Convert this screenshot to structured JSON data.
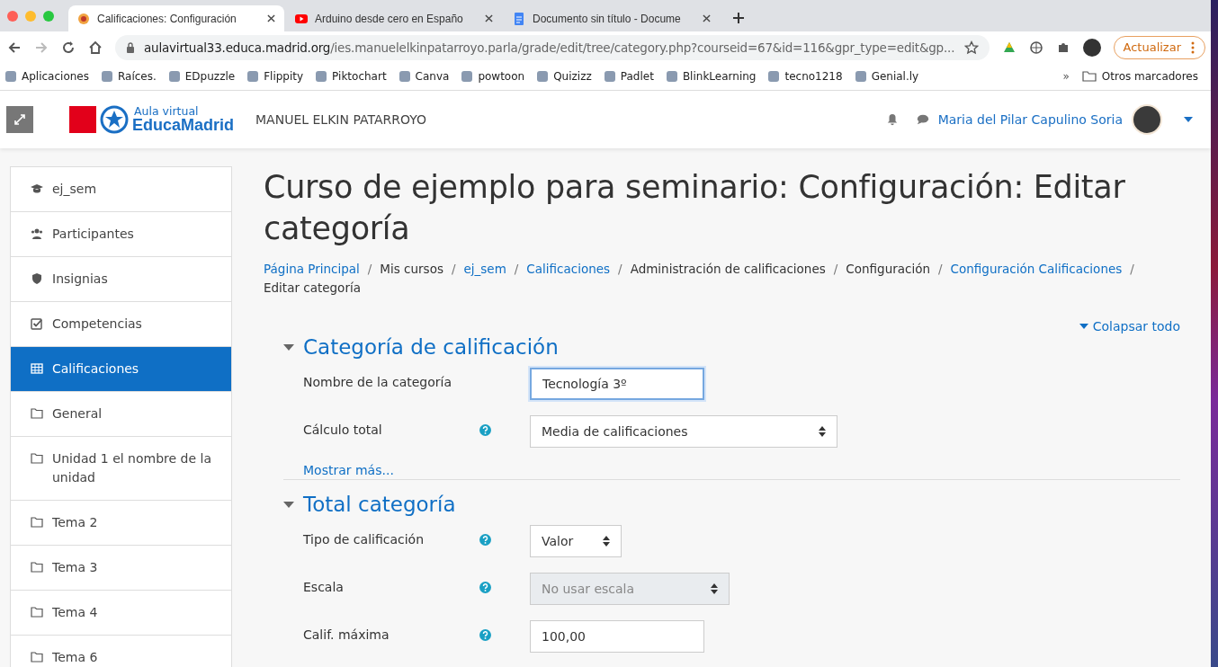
{
  "browser": {
    "tabs": [
      {
        "title": "Calificaciones: Configuración",
        "selected": true
      },
      {
        "title": "Arduino desde cero en Españo",
        "selected": false
      },
      {
        "title": "Documento sin título - Docume",
        "selected": false
      }
    ],
    "url_host": "aulavirtual33.educa.madrid.org",
    "url_path": "/ies.manuelelkinpatarroyo.parla/grade/edit/tree/category.php?courseid=67&id=116&gpr_type=edit&gp...",
    "update_button": "Actualizar",
    "bookmarks": [
      "Aplicaciones",
      "Raíces.",
      "EDpuzzle",
      "Flippity",
      "Piktochart",
      "Canva",
      "powtoon",
      "Quizizz",
      "Padlet",
      "BlinkLearning",
      "tecno1218",
      "Genial.ly"
    ],
    "more_bookmarks": "»",
    "other_bookmarks": "Otros marcadores"
  },
  "header": {
    "logo_top": "Aula virtual",
    "logo_bottom": "EducaMadrid",
    "site_name": "MANUEL ELKIN PATARROYO",
    "user_name": "Maria del Pilar Capulino Soria"
  },
  "sidebar": {
    "items": [
      {
        "label": "ej_sem",
        "selected": false
      },
      {
        "label": "Participantes",
        "selected": false
      },
      {
        "label": "Insignias",
        "selected": false
      },
      {
        "label": "Competencias",
        "selected": false
      },
      {
        "label": "Calificaciones",
        "selected": true
      },
      {
        "label": "General",
        "selected": false
      },
      {
        "label": "Unidad 1 el nombre de la unidad",
        "selected": false
      },
      {
        "label": "Tema 2",
        "selected": false
      },
      {
        "label": "Tema 3",
        "selected": false
      },
      {
        "label": "Tema 4",
        "selected": false
      },
      {
        "label": "Tema 6",
        "selected": false
      }
    ]
  },
  "page": {
    "title": "Curso de ejemplo para seminario: Configuración: Editar categoría",
    "breadcrumb_separator": "/",
    "breadcrumb": [
      {
        "label": "Página Principal",
        "link": true
      },
      {
        "label": "Mis cursos",
        "link": false
      },
      {
        "label": "ej_sem",
        "link": true
      },
      {
        "label": "Calificaciones",
        "link": true
      },
      {
        "label": "Administración de calificaciones",
        "link": false
      },
      {
        "label": "Configuración",
        "link": false
      },
      {
        "label": "Configuración Calificaciones",
        "link": true
      },
      {
        "label": "Editar categoría",
        "link": false
      }
    ],
    "collapse_all": "Colapsar todo",
    "sections": [
      {
        "title": "Categoría de calificación",
        "expanded": true,
        "fields": [
          {
            "label": "Nombre de la categoría",
            "kind": "text",
            "value": "Tecnología 3º",
            "help": false,
            "focused": true
          },
          {
            "label": "Cálculo total",
            "kind": "select",
            "value": "Media de calificaciones",
            "help": true,
            "disabled": false
          }
        ],
        "more_link": "Mostrar más..."
      },
      {
        "title": "Total categoría",
        "expanded": true,
        "fields": [
          {
            "label": "Tipo de calificación",
            "kind": "select",
            "value": "Valor",
            "help": true,
            "disabled": false
          },
          {
            "label": "Escala",
            "kind": "select",
            "value": "No usar escala",
            "help": true,
            "disabled": true
          },
          {
            "label": "Calif. máxima",
            "kind": "text",
            "value": "100,00",
            "help": true,
            "focused": false
          }
        ]
      }
    ]
  }
}
